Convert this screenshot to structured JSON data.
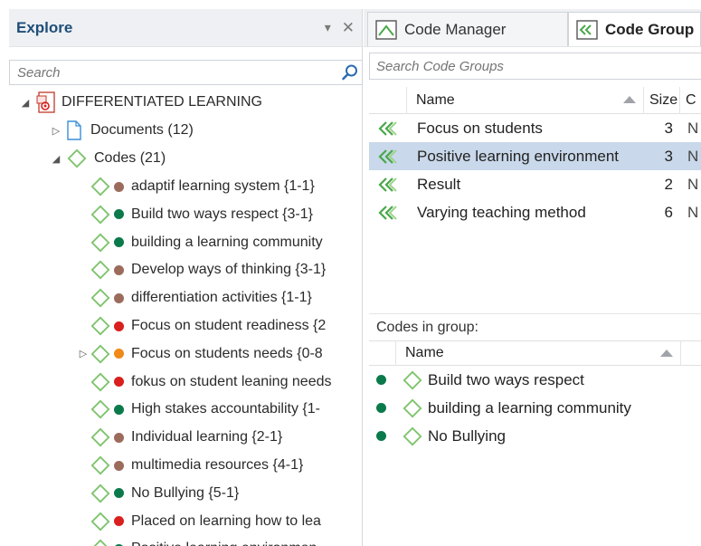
{
  "explore": {
    "title": "Explore",
    "pin_glyph": "▾",
    "close_glyph": "✕",
    "search_placeholder": "Search"
  },
  "tree": {
    "root": {
      "label": "DIFFERENTIATED LEARNING",
      "icon": "project-icon"
    },
    "documents": {
      "label": "Documents (12)",
      "icon": "document-icon"
    },
    "codes": {
      "label": "Codes (21)",
      "icon": "code-icon"
    },
    "code_items": [
      {
        "label": "adaptif learning system {1-1}",
        "color": "#9b6b5b",
        "expandable": false
      },
      {
        "label": "Build two ways respect {3-1}",
        "color": "#0b7a4b",
        "expandable": false
      },
      {
        "label": "building a learning community",
        "color": "#0b7a4b",
        "expandable": false
      },
      {
        "label": "Develop ways of thinking {3-1}",
        "color": "#9b6b5b",
        "expandable": false
      },
      {
        "label": "differentiation activities {1-1}",
        "color": "#9b6b5b",
        "expandable": false
      },
      {
        "label": "Focus on student readiness {2",
        "color": "#d9201e",
        "expandable": false
      },
      {
        "label": "Focus on students needs {0-8",
        "color": "#f0891a",
        "expandable": true
      },
      {
        "label": "fokus on student leaning needs",
        "color": "#d9201e",
        "expandable": false
      },
      {
        "label": "High stakes accountability {1-",
        "color": "#0b7a4b",
        "expandable": false
      },
      {
        "label": "Individual learning {2-1}",
        "color": "#9b6b5b",
        "expandable": false
      },
      {
        "label": "multimedia resources {4-1}",
        "color": "#9b6b5b",
        "expandable": false
      },
      {
        "label": "No Bullying {5-1}",
        "color": "#0b7a4b",
        "expandable": false
      },
      {
        "label": "Placed on learning how to lea",
        "color": "#d9201e",
        "expandable": false
      },
      {
        "label": "Positive learning environmen",
        "color": "#0b7a4b",
        "expandable": true
      }
    ]
  },
  "tabs": [
    {
      "label": "Code Manager",
      "icon": "code-manager-icon",
      "active": false
    },
    {
      "label": "Code Group",
      "icon": "code-group-icon",
      "active": true
    }
  ],
  "code_groups": {
    "search_placeholder": "Search Code Groups",
    "columns": {
      "name": "Name",
      "size": "Size",
      "c": "C"
    },
    "rows": [
      {
        "name": "Focus on students",
        "size": "3",
        "c": "N",
        "selected": false
      },
      {
        "name": "Positive learning environment",
        "size": "3",
        "c": "N",
        "selected": true
      },
      {
        "name": "Result",
        "size": "2",
        "c": "N",
        "selected": false
      },
      {
        "name": "Varying teaching method",
        "size": "6",
        "c": "N",
        "selected": false
      }
    ]
  },
  "codes_in_group": {
    "label": "Codes in group:",
    "column_name": "Name",
    "rows": [
      {
        "name": "Build two ways respect",
        "color": "#0b7a4b"
      },
      {
        "name": "building a learning community",
        "color": "#0b7a4b"
      },
      {
        "name": "No Bullying",
        "color": "#0b7a4b"
      }
    ]
  },
  "colors": {
    "code_diamond": "#7cc36a",
    "code_group_icon": "#4aa84a",
    "selected_row": "#c9d8ea",
    "title_blue": "#1f4e79"
  }
}
